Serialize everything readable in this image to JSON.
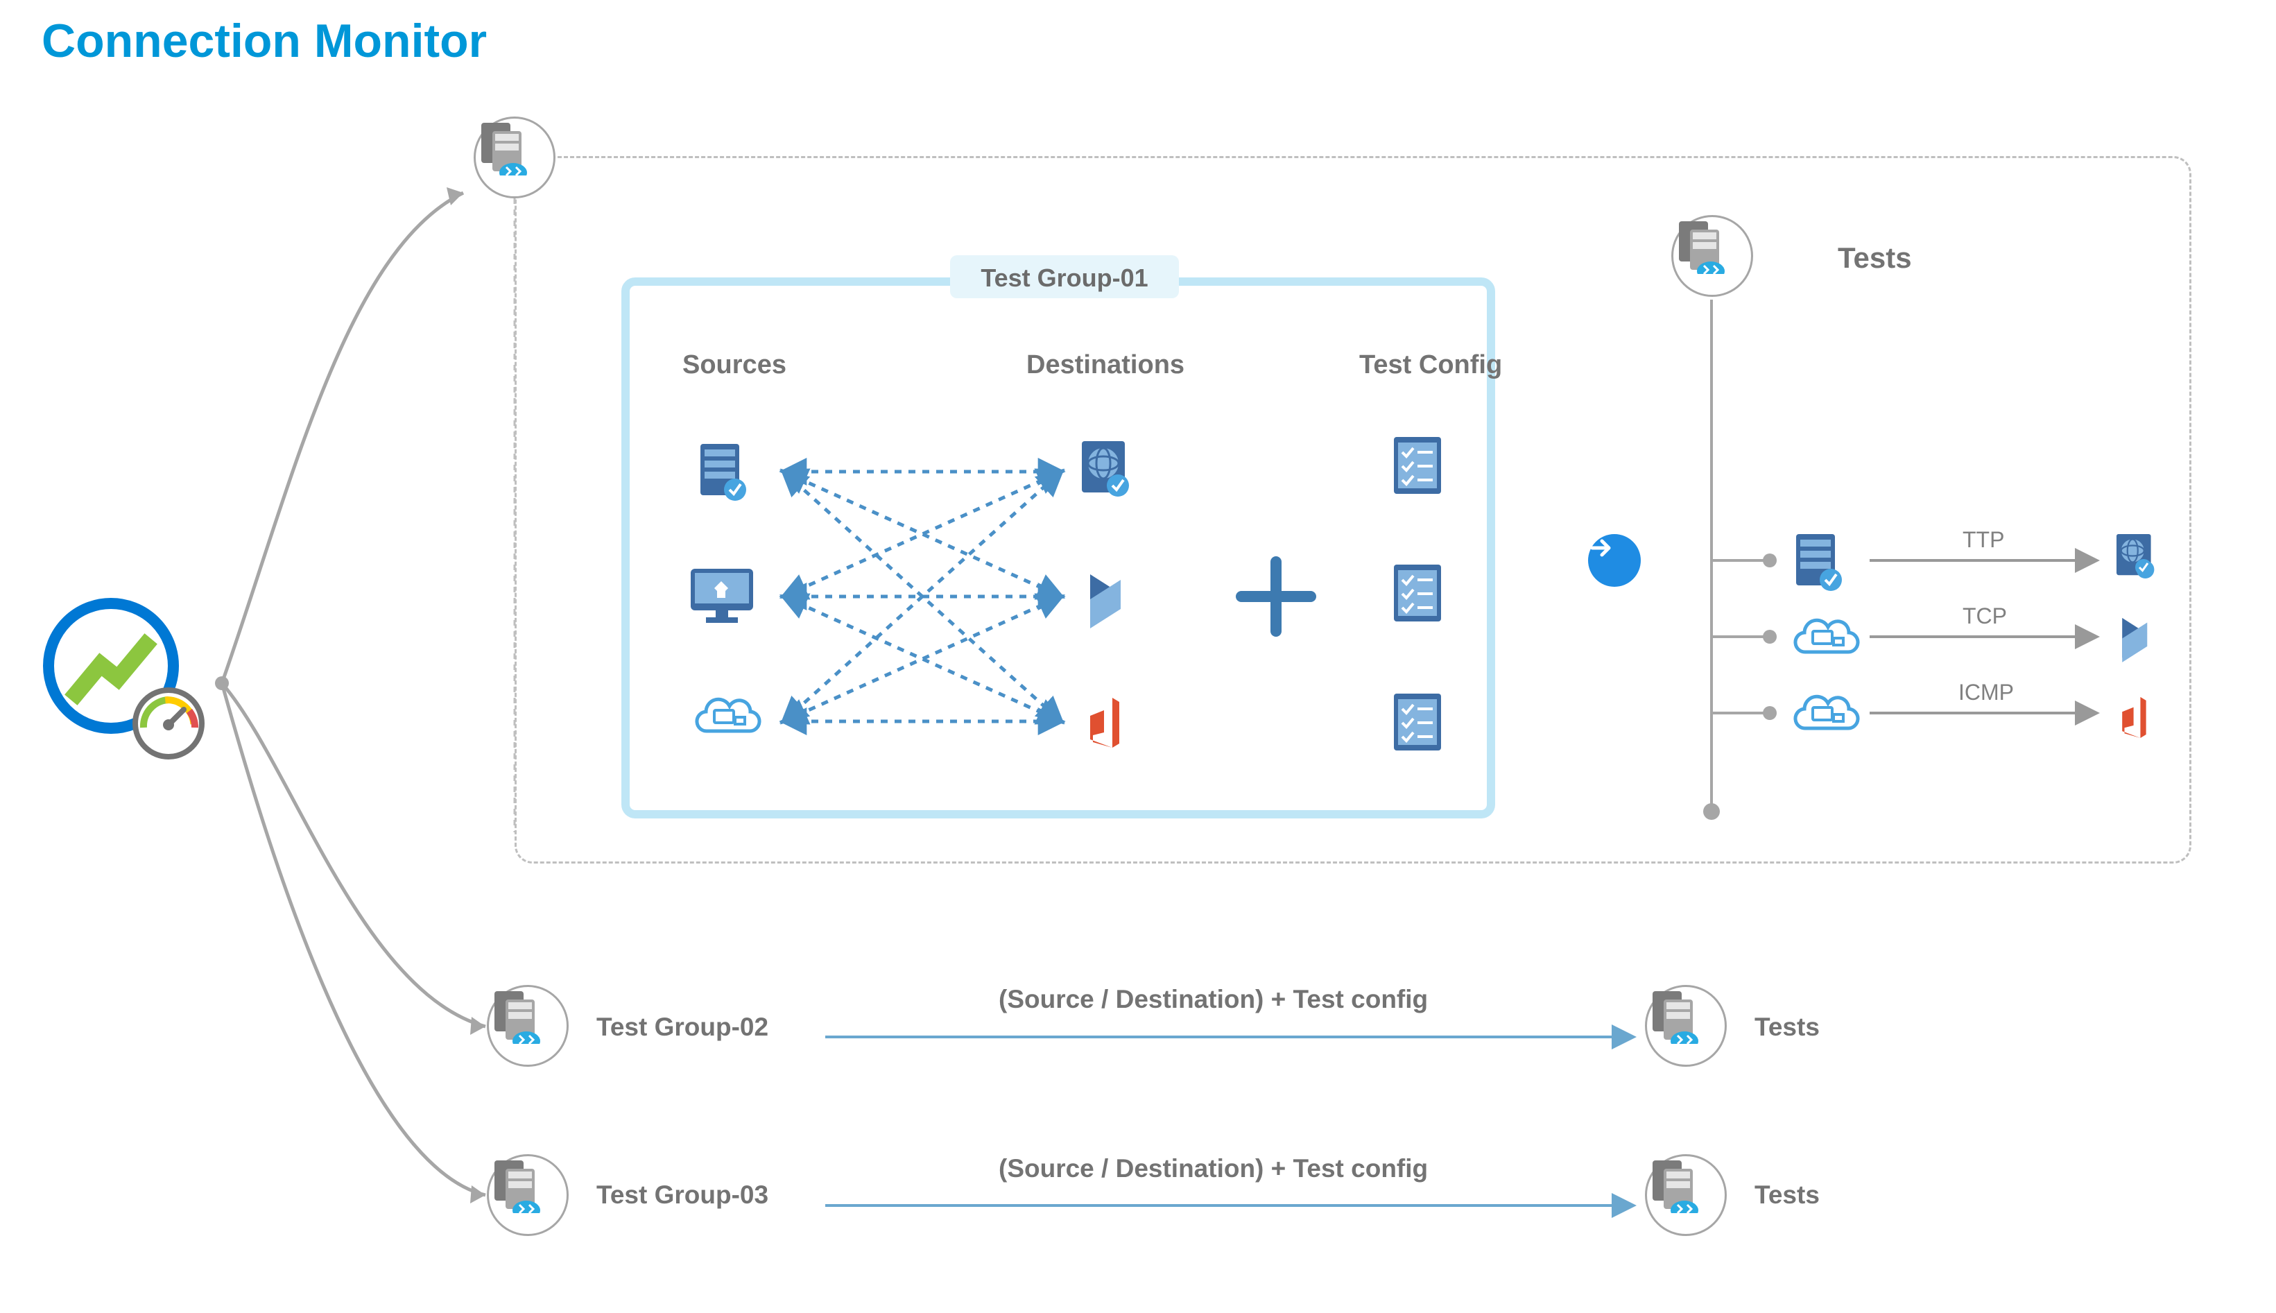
{
  "title": "Connection Monitor",
  "testGroup1": {
    "tab": "Test Group-01",
    "columns": {
      "sources": "Sources",
      "destinations": "Destinations",
      "config": "Test Config"
    }
  },
  "testsHeading": "Tests",
  "tests": {
    "row1": "TTP",
    "row2": "TCP",
    "row3": "ICMP"
  },
  "rows": {
    "tg2": {
      "name": "Test Group-02",
      "arrowLabel": "(Source / Destination) + Test config",
      "right": "Tests"
    },
    "tg3": {
      "name": "Test Group-03",
      "arrowLabel": "(Source / Destination) + Test config",
      "right": "Tests"
    }
  },
  "colors": {
    "titleBlue": "#0097d8",
    "accentBlue": "#1f8ce3",
    "nodeGrey": "#a6a6a6",
    "darkBlue": "#3d6ca4",
    "lightBlue": "#7db4e1",
    "tabBg": "#e6f5fb",
    "tgBorder": "#bfe6f6"
  }
}
